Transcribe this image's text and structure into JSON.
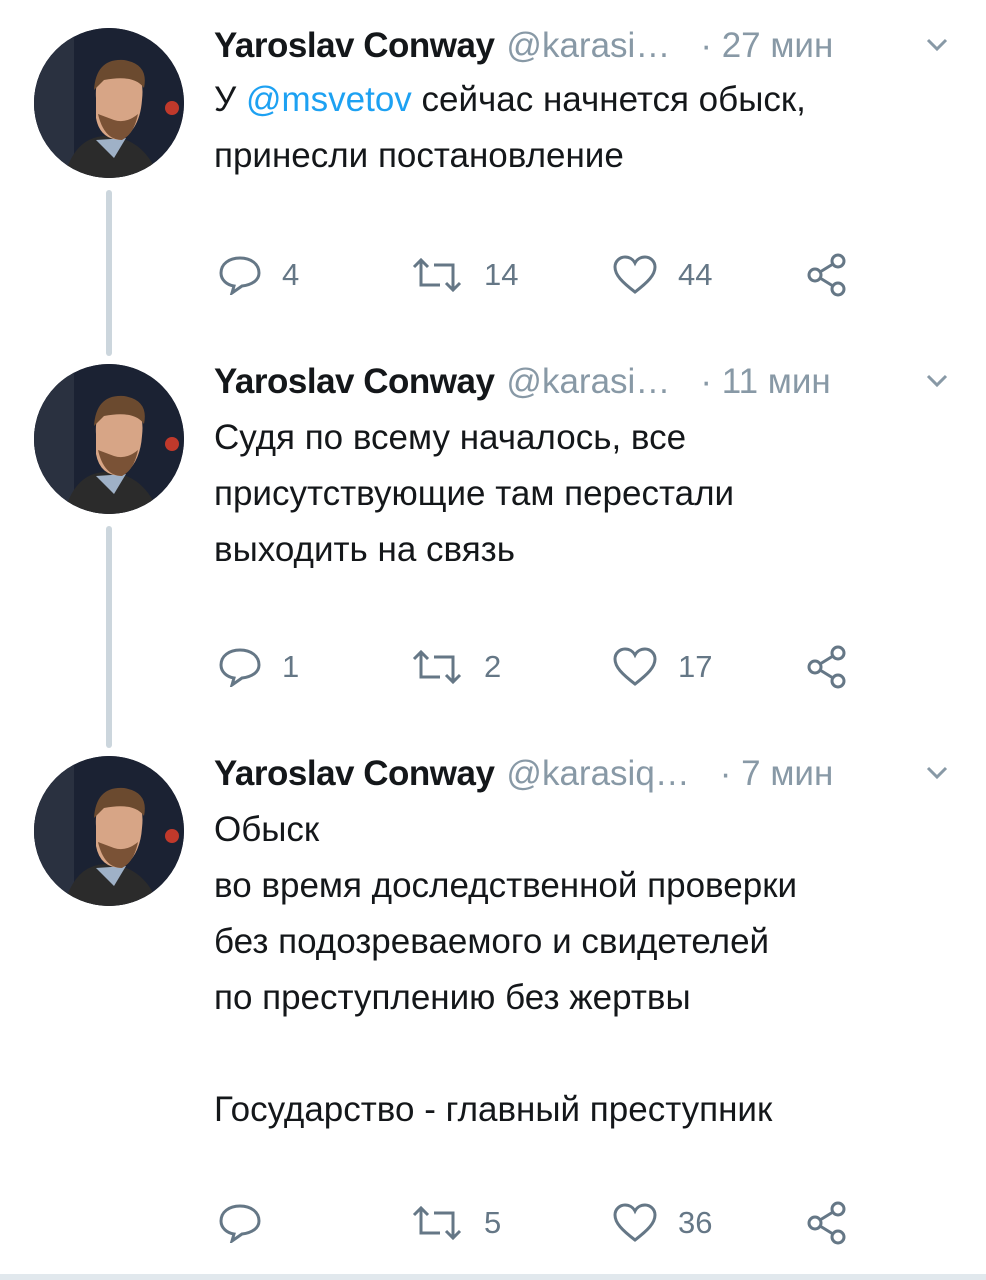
{
  "colors": {
    "accent": "#1da1f2",
    "secondary_text": "#8899a6",
    "thread_line": "#ccd6dd"
  },
  "tweets": [
    {
      "author": "Yaroslav Conway",
      "handle": "@karasi…",
      "time": "· 27 мин",
      "text_before": "У ",
      "mention": "@msvetov",
      "text_after": " сейчас начнется обыск, принесли постановление",
      "replies": "4",
      "retweets": "14",
      "likes": "44"
    },
    {
      "author": "Yaroslav Conway",
      "handle": "@karasi…",
      "time": "· 11 мин",
      "lines": [
        "Судя по всему началось, все",
        "присутствующие там перестали",
        "выходить на связь"
      ],
      "replies": "1",
      "retweets": "2",
      "likes": "17"
    },
    {
      "author": "Yaroslav Conway",
      "handle": "@karasiq…",
      "time": "· 7 мин",
      "lines": [
        "Обыск",
        "во время доследственной проверки",
        "без подозреваемого и свидетелей",
        "по преступлению без жертвы",
        "",
        "Государство - главный преступник"
      ],
      "replies": "",
      "retweets": "5",
      "likes": "36"
    }
  ],
  "icons": {
    "avatar": "avatar-photo",
    "caret": "chevron-down-icon",
    "reply": "reply-icon",
    "retweet": "retweet-icon",
    "like": "heart-icon",
    "share": "share-icon"
  }
}
